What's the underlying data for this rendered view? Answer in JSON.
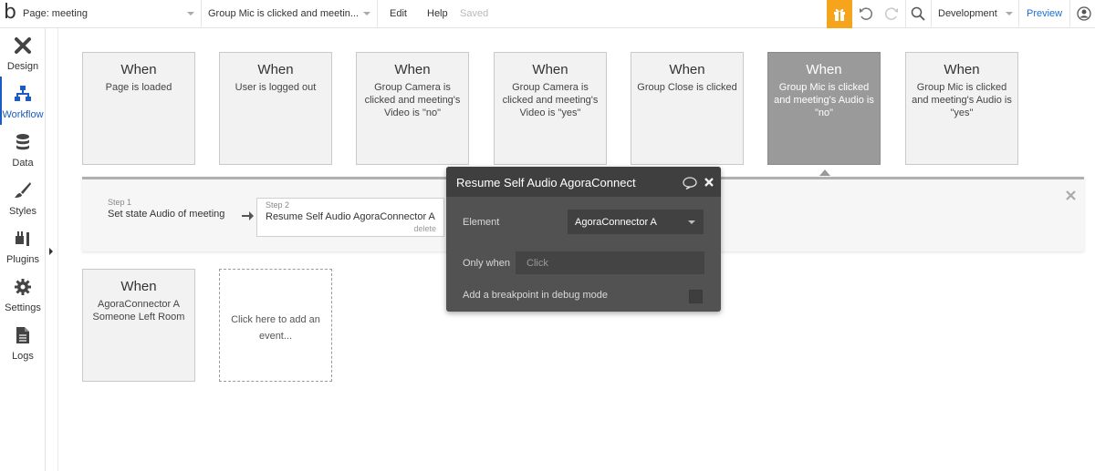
{
  "topbar": {
    "logo": "b",
    "page_label": "Page: meeting",
    "workflow_selector": "Group Mic is clicked and meetin...",
    "edit": "Edit",
    "help": "Help",
    "saved_status": "Saved",
    "environment": "Development",
    "preview": "Preview",
    "accent_color": "#f7a41d",
    "icons": [
      "gift-icon",
      "undo-icon",
      "redo-icon",
      "search-icon",
      "user-icon"
    ]
  },
  "sidebar": {
    "items": [
      {
        "label": "Design",
        "icon": "design-tools-icon"
      },
      {
        "label": "Workflow",
        "icon": "workflow-icon",
        "active": true
      },
      {
        "label": "Data",
        "icon": "database-icon"
      },
      {
        "label": "Styles",
        "icon": "brush-icon"
      },
      {
        "label": "Plugins",
        "icon": "plug-icon"
      },
      {
        "label": "Settings",
        "icon": "gear-icon"
      },
      {
        "label": "Logs",
        "icon": "document-icon"
      }
    ],
    "active_color": "#1b5bc4"
  },
  "events": [
    {
      "when": "When",
      "desc": "Page is loaded"
    },
    {
      "when": "When",
      "desc": "User is logged out"
    },
    {
      "when": "When",
      "desc": "Group Camera is clicked and meeting's Video is \"no\""
    },
    {
      "when": "When",
      "desc": "Group Camera is clicked and meeting's Video is \"yes\""
    },
    {
      "when": "When",
      "desc": "Group Close is clicked"
    },
    {
      "when": "When",
      "desc": "Group Mic is clicked and meeting's Audio is \"no\"",
      "selected": true
    },
    {
      "when": "When",
      "desc": "Group Mic is clicked and meeting's Audio is \"yes\""
    },
    {
      "when": "When",
      "desc": "AgoraConnector A Someone Left Room"
    }
  ],
  "add_event": "Click here to add an event...",
  "workflow": {
    "steps": [
      {
        "num": "Step 1",
        "name": "Set state Audio of meeting"
      },
      {
        "num": "Step 2",
        "name": "Resume Self Audio AgoraConnector A",
        "delete": "delete"
      }
    ]
  },
  "property_editor": {
    "title": "Resume Self Audio AgoraConnect",
    "element_label": "Element",
    "element_value": "AgoraConnector A",
    "only_when_label": "Only when",
    "only_when_placeholder": "Click",
    "breakpoint_label": "Add a breakpoint in debug mode"
  }
}
